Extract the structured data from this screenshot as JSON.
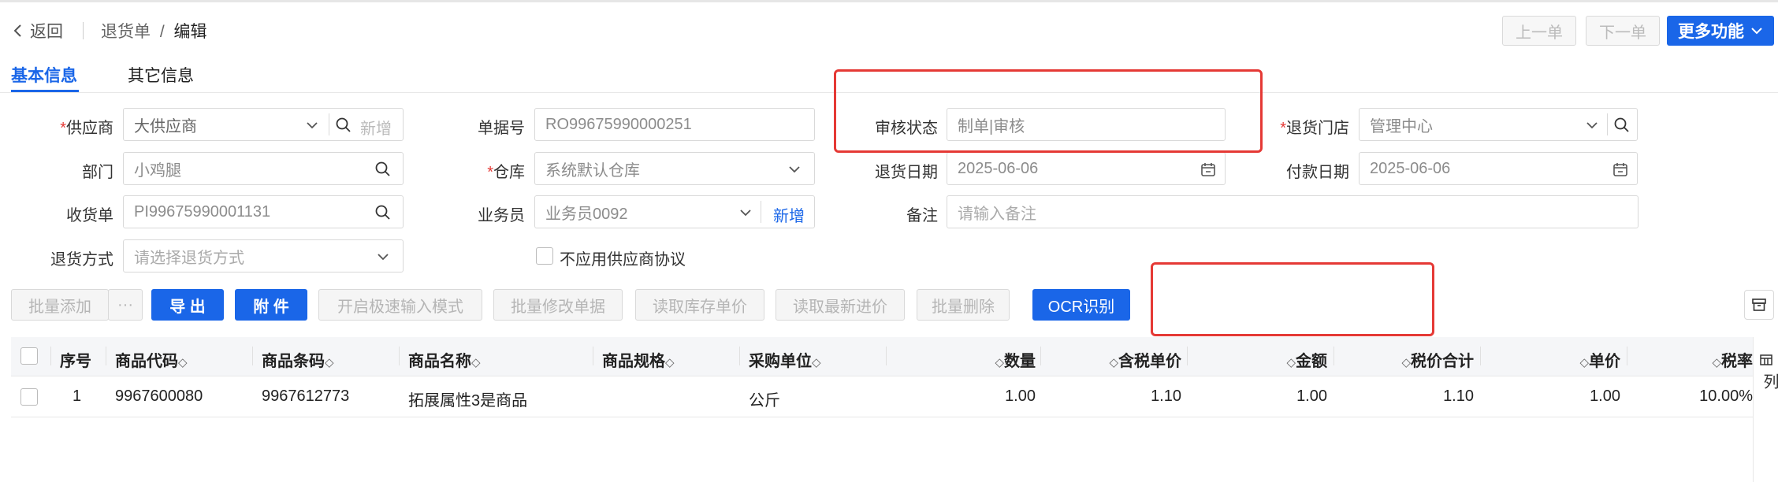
{
  "header": {
    "back_label": "返回",
    "breadcrumb_parent": "退货单",
    "breadcrumb_sep": "/",
    "breadcrumb_current": "编辑",
    "prev_label": "上一单",
    "next_label": "下一单",
    "more_label": "更多功能"
  },
  "tabs": [
    {
      "label": "基本信息",
      "active": true
    },
    {
      "label": "其它信息",
      "active": false
    }
  ],
  "form": {
    "supplier": {
      "label": "供应商",
      "required": true,
      "value": "大供应商",
      "add": "新增"
    },
    "doc_no": {
      "label": "单据号",
      "value": "RO99675990000251"
    },
    "audit_status": {
      "label": "审核状态",
      "value": "制单|审核"
    },
    "return_store": {
      "label": "退货门店",
      "required": true,
      "value": "管理中心"
    },
    "department": {
      "label": "部门",
      "value": "小鸡腿"
    },
    "warehouse": {
      "label": "仓库",
      "required": true,
      "value": "系统默认仓库"
    },
    "return_date": {
      "label": "退货日期",
      "value": "2025-06-06"
    },
    "pay_date": {
      "label": "付款日期",
      "value": "2025-06-06"
    },
    "receipt_no": {
      "label": "收货单",
      "value": "PI99675990001131"
    },
    "salesman": {
      "label": "业务员",
      "value": "业务员0092",
      "add": "新增"
    },
    "remark": {
      "label": "备注",
      "placeholder": "请输入备注"
    },
    "return_method": {
      "label": "退货方式",
      "placeholder": "请选择退货方式"
    },
    "no_supplier_agreement": {
      "label": "不应用供应商协议",
      "checked": false
    }
  },
  "toolbar": {
    "batch_add": "批量添加",
    "more": "···",
    "export": "导 出",
    "attachment": "附 件",
    "fast_input": "开启极速输入模式",
    "batch_modify": "批量修改单据",
    "read_stock_price": "读取库存单价",
    "read_latest_price": "读取最新进价",
    "batch_delete": "批量删除",
    "ocr": "OCR识别"
  },
  "table": {
    "columns": [
      "序号",
      "商品代码",
      "商品条码",
      "商品名称",
      "商品规格",
      "采购单位",
      "数量",
      "含税单价",
      "金额",
      "税价合计",
      "单价",
      "税率"
    ],
    "rows": [
      {
        "seq": "1",
        "code": "9967600080",
        "barcode": "9967612773",
        "name": "拓展属性3是商品",
        "spec": "",
        "unit": "公斤",
        "qty": "1.00",
        "tax_price": "1.10",
        "amount": "1.00",
        "tax_total": "1.10",
        "price": "1.00",
        "tax_rate": "10.00%"
      }
    ],
    "side_label": "列"
  },
  "colors": {
    "accent": "#1a66e8",
    "highlight_box": "#e53935"
  }
}
